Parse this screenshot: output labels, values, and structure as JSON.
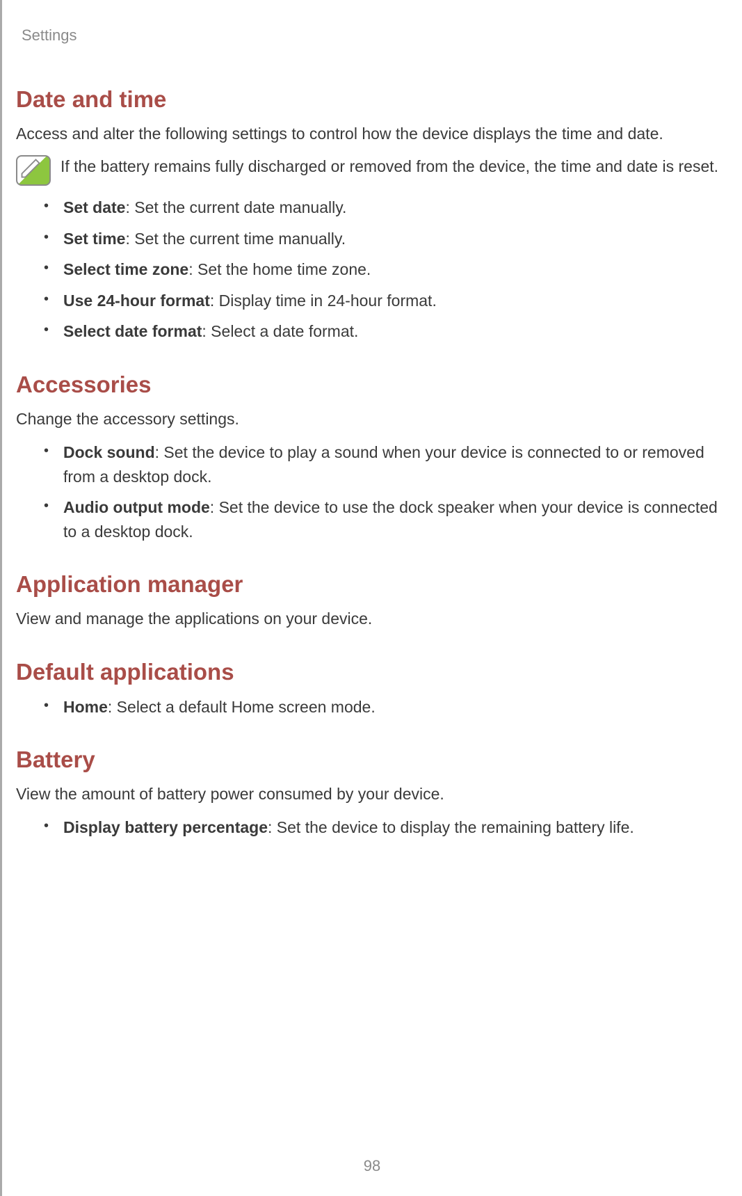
{
  "header": "Settings",
  "page_number": "98",
  "sections": {
    "date_time": {
      "heading": "Date and time",
      "intro": "Access and alter the following settings to control how the device displays the time and date.",
      "note": "If the battery remains fully discharged or removed from the device, the time and date is reset.",
      "items": [
        {
          "term": "Set date",
          "desc": ": Set the current date manually."
        },
        {
          "term": "Set time",
          "desc": ": Set the current time manually."
        },
        {
          "term": "Select time zone",
          "desc": ": Set the home time zone."
        },
        {
          "term": "Use 24-hour format",
          "desc": ": Display time in 24-hour format."
        },
        {
          "term": "Select date format",
          "desc": ": Select a date format."
        }
      ]
    },
    "accessories": {
      "heading": "Accessories",
      "intro": "Change the accessory settings.",
      "items": [
        {
          "term": "Dock sound",
          "desc": ": Set the device to play a sound when your device is connected to or removed from a desktop dock."
        },
        {
          "term": "Audio output mode",
          "desc": ": Set the device to use the dock speaker when your device is connected to a desktop dock."
        }
      ]
    },
    "app_manager": {
      "heading": "Application manager",
      "intro": "View and manage the applications on your device."
    },
    "default_apps": {
      "heading": "Default applications",
      "items": [
        {
          "term": "Home",
          "desc": ": Select a default Home screen mode."
        }
      ]
    },
    "battery": {
      "heading": "Battery",
      "intro": "View the amount of battery power consumed by your device.",
      "items": [
        {
          "term": "Display battery percentage",
          "desc": ": Set the device to display the remaining battery life."
        }
      ]
    }
  }
}
